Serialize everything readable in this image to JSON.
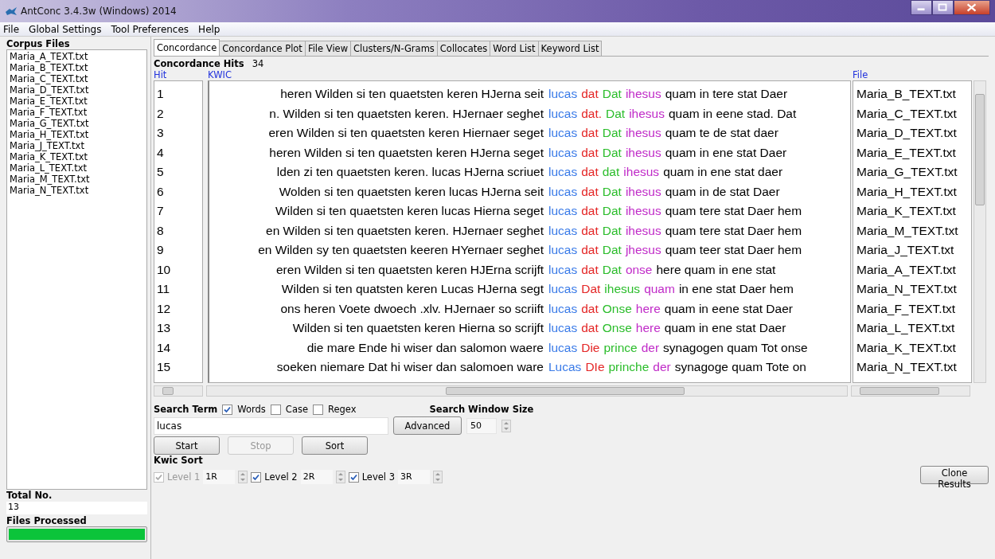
{
  "window": {
    "title": "AntConc 3.4.3w (Windows) 2014"
  },
  "menu": [
    "File",
    "Global Settings",
    "Tool Preferences",
    "Help"
  ],
  "corpus_panel": {
    "heading": "Corpus Files",
    "files": [
      "Maria_A_TEXT.txt",
      "Maria_B_TEXT.txt",
      "Maria_C_TEXT.txt",
      "Maria_D_TEXT.txt",
      "Maria_E_TEXT.txt",
      "Maria_F_TEXT.txt",
      "Maria_G_TEXT.txt",
      "Maria_H_TEXT.txt",
      "Maria_J_TEXT.txt",
      "Maria_K_TEXT.txt",
      "Maria_L_TEXT.txt",
      "Maria_M_TEXT.txt",
      "Maria_N_TEXT.txt"
    ],
    "total_label": "Total No.",
    "total_value": "13",
    "processed_label": "Files Processed",
    "progress": {
      "level": 1
    }
  },
  "tabs": [
    {
      "label": "Concordance",
      "selected": true
    },
    {
      "label": "Concordance Plot",
      "selected": false
    },
    {
      "label": "File View",
      "selected": false
    },
    {
      "label": "Clusters/N-Grams",
      "selected": false
    },
    {
      "label": "Collocates",
      "selected": false
    },
    {
      "label": "Word List",
      "selected": false
    },
    {
      "label": "Keyword List",
      "selected": false
    }
  ],
  "hits": {
    "label": "Concordance Hits",
    "count": "34"
  },
  "table": {
    "columns": [
      "Hit",
      "KWIC",
      "File"
    ],
    "rows": [
      {
        "hit": "1",
        "left": "heren Wilden si ten quaetsten keren HJerna seit",
        "keyword": "lucas",
        "level_1": "dat",
        "level_2": "Dat",
        "level_3": "ihesus",
        "right": "quam in tere stat Daer",
        "file": "Maria_B_TEXT.txt"
      },
      {
        "hit": "2",
        "left": "n. Wilden si ten quaetsten keren. HJernaer seghet",
        "keyword": "lucas",
        "level_1": "dat.",
        "level_2": "Dat",
        "level_3": "ihesus",
        "right": "quam in eene stad. Dat",
        "file": "Maria_C_TEXT.txt"
      },
      {
        "hit": "3",
        "left": "eren Wilden si ten quaetsten keren Hiernaer seget",
        "keyword": "lucas",
        "level_1": "dat",
        "level_2": "Dat",
        "level_3": "ihesus",
        "right": "quam te de stat daer",
        "file": "Maria_D_TEXT.txt"
      },
      {
        "hit": "4",
        "left": "heren Wilden si ten quaetsten keren HJerna seget",
        "keyword": "lucas",
        "level_1": "dat",
        "level_2": "Dat",
        "level_3": "ihesus",
        "right": "quam in ene stat Daer",
        "file": "Maria_E_TEXT.txt"
      },
      {
        "hit": "5",
        "left": "lden zi ten quaetsten keren. lucas HJerna scriuet",
        "keyword": "lucas",
        "level_1": "dat",
        "level_2": "dat",
        "level_3": "ihesus",
        "right": "quam in ene stat daer",
        "file": "Maria_G_TEXT.txt"
      },
      {
        "hit": "6",
        "left": "Wolden si ten quaetsten keren lucas HJerna seit",
        "keyword": "lucas",
        "level_1": "dat",
        "level_2": "Dat",
        "level_3": "ihesus",
        "right": "quam in de stat Daer",
        "file": "Maria_H_TEXT.txt"
      },
      {
        "hit": "7",
        "left": "Wilden si ten quaetsten keren lucas Hierna seget",
        "keyword": "lucas",
        "level_1": "dat",
        "level_2": "Dat",
        "level_3": "ihesus",
        "right": "quam tere stat Daer hem",
        "file": "Maria_K_TEXT.txt"
      },
      {
        "hit": "8",
        "left": "en Wilden si ten quaetsten keren. HJernaer seghet",
        "keyword": "lucas",
        "level_1": "dat",
        "level_2": "Dat",
        "level_3": "ihesus",
        "right": "quam tere stat Daer hem",
        "file": "Maria_M_TEXT.txt"
      },
      {
        "hit": "9",
        "left": "en Wilden sy ten quaetsten keeren HYernaer seghet",
        "keyword": "lucas",
        "level_1": "dat",
        "level_2": "Dat",
        "level_3": "jhesus",
        "right": "quam teer stat Daer hem",
        "file": "Maria_J_TEXT.txt"
      },
      {
        "hit": "10",
        "left": "eren Wilden si ten quaetsten keren HJErna scrijft",
        "keyword": "lucas",
        "level_1": "dat",
        "level_2": "Dat",
        "level_3": "onse",
        "right": "here quam in ene stat",
        "file": "Maria_A_TEXT.txt"
      },
      {
        "hit": "11",
        "left": "Wilden si ten quatsten keren Lucas HJerna segt",
        "keyword": "lucas",
        "level_1": "Dat",
        "level_2": "ihesus",
        "level_3": "quam",
        "right": "in ene stat Daer hem",
        "file": "Maria_N_TEXT.txt"
      },
      {
        "hit": "12",
        "left": "ons heren Voete dwoech .xlv. HJernaer so scriift",
        "keyword": "lucas",
        "level_1": "dat",
        "level_2": "Onse",
        "level_3": "here",
        "right": "quam in eene stat Daer",
        "file": "Maria_F_TEXT.txt"
      },
      {
        "hit": "13",
        "left": "Wilden si ten quaetsten keren Hierna so scrijft",
        "keyword": "lucas",
        "level_1": "dat",
        "level_2": "Onse",
        "level_3": "here",
        "right": "quam in ene stat Daer",
        "file": "Maria_L_TEXT.txt"
      },
      {
        "hit": "14",
        "left": "die mare Ende hi wiser dan salomon waere",
        "keyword": "lucas",
        "level_1": "Die",
        "level_2": "prince",
        "level_3": "der",
        "right": "synagogen quam Tot onse",
        "file": "Maria_K_TEXT.txt"
      },
      {
        "hit": "15",
        "left": "soeken niemare Dat hi wiser dan salomoen ware",
        "keyword": "Lucas",
        "level_1": "DIe",
        "level_2": "prinche",
        "level_3": "der",
        "right": "synagoge quam Tote on",
        "file": "Maria_N_TEXT.txt"
      }
    ]
  },
  "search": {
    "label": "Search Term",
    "options": [
      {
        "label": "Words",
        "checked": true
      },
      {
        "label": "Case",
        "checked": false
      },
      {
        "label": "Regex",
        "checked": false
      }
    ],
    "value": "lucas",
    "advanced_button": "Advanced",
    "window_size_label": "Search Window Size",
    "window_size": "50"
  },
  "buttons": [
    {
      "label": "Start",
      "disabled": false
    },
    {
      "label": "Stop",
      "disabled": true
    },
    {
      "label": "Sort",
      "disabled": false
    }
  ],
  "kwic_sort": {
    "label": "Kwic Sort",
    "levels": [
      {
        "label": "Level 1",
        "checked": true,
        "disabled": true,
        "value": "1R"
      },
      {
        "label": "Level 2",
        "checked": true,
        "disabled": false,
        "value": "2R"
      },
      {
        "label": "Level 3",
        "checked": true,
        "disabled": false,
        "value": "3R"
      }
    ]
  },
  "clone_button": "Clone Results"
}
